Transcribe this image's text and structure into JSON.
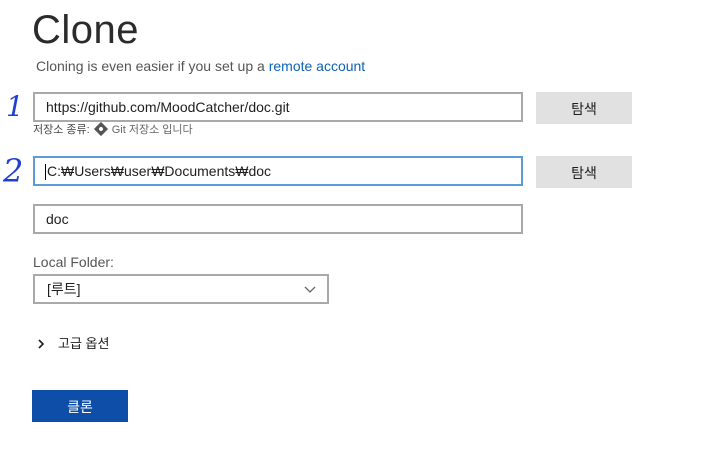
{
  "header": {
    "title": "Clone",
    "subtitle_prefix": "Cloning is even easier if you set up a ",
    "subtitle_link": "remote account"
  },
  "annotations": {
    "mark_1": "1",
    "mark_2": "2"
  },
  "repo_url": {
    "value": "https://github.com/MoodCatcher/doc.git",
    "browse_label": "탐색"
  },
  "repo_type": {
    "label": "저장소 종류:",
    "icon": "git-icon",
    "text": "Git 저장소 입니다"
  },
  "local_path": {
    "value": "C:₩Users₩user₩Documents₩doc",
    "browse_label": "탐색"
  },
  "repo_name": {
    "value": "doc"
  },
  "local_folder": {
    "label": "Local Folder:",
    "selected": "[루트]",
    "icon": "chevron-down-icon"
  },
  "advanced": {
    "label": "고급 옵션",
    "icon": "chevron-right-icon"
  },
  "actions": {
    "clone_label": "클론",
    "accent_color": "#0e4ea8"
  }
}
